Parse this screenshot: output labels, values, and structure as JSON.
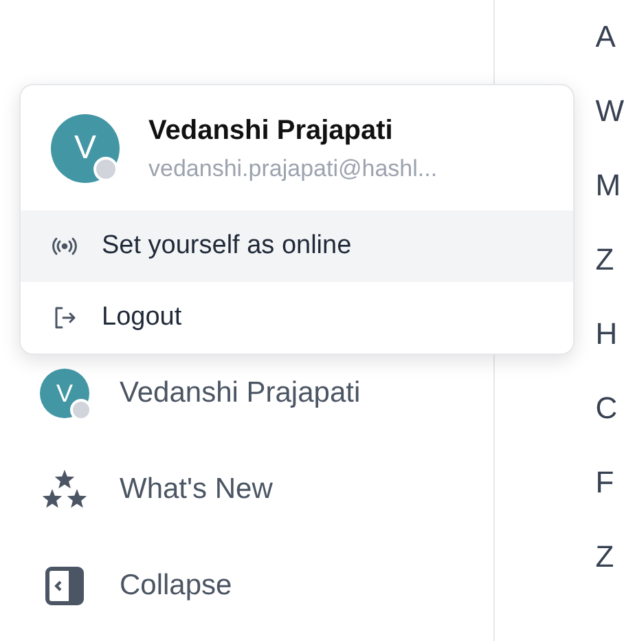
{
  "popup": {
    "user": {
      "initial": "V",
      "name": "Vedanshi Prajapati",
      "email": "vedanshi.prajapati@hashl...",
      "online": false
    },
    "items": [
      {
        "kind": "status",
        "label": "Set yourself as online",
        "highlighted": true
      },
      {
        "kind": "logout",
        "label": "Logout",
        "highlighted": false
      }
    ]
  },
  "sidebar": {
    "items": [
      {
        "kind": "profile",
        "initial": "V",
        "label": "Vedanshi Prajapati",
        "online": false
      },
      {
        "kind": "whats-new",
        "label": "What's New"
      },
      {
        "kind": "collapse",
        "label": "Collapse"
      }
    ]
  },
  "list_column": [
    "A",
    "W",
    "M",
    "Z",
    "H",
    "C",
    "F",
    "Z"
  ]
}
